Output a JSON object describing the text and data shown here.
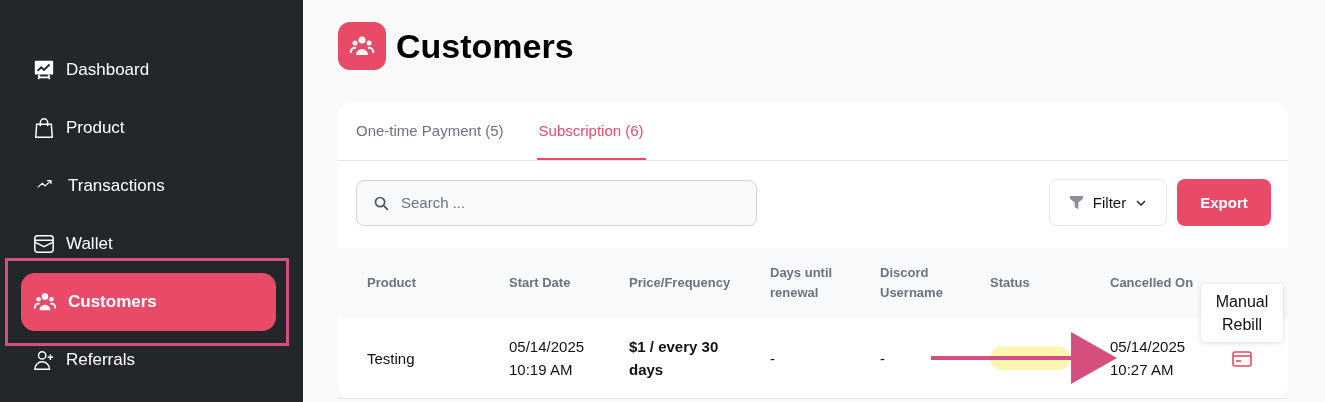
{
  "sidebar": {
    "items": [
      {
        "label": "Dashboard",
        "kind": "dashboard",
        "selected": false
      },
      {
        "label": "Product",
        "kind": "bag",
        "selected": false
      },
      {
        "label": "Transactions",
        "kind": "trend",
        "selected": false
      },
      {
        "label": "Wallet",
        "kind": "wallet",
        "selected": false
      },
      {
        "label": "Customers",
        "kind": "users",
        "selected": true
      },
      {
        "label": "Referrals",
        "kind": "user-plus",
        "selected": false
      }
    ]
  },
  "page": {
    "title": "Customers"
  },
  "tabs": [
    {
      "label": "One-time Payment (5)",
      "selected": false
    },
    {
      "label": "Subscription (6)",
      "selected": true
    }
  ],
  "search": {
    "placeholder": "Search ..."
  },
  "filter_button": "Filter",
  "export_button": "Export",
  "table": {
    "columns": [
      "Product",
      "Start Date",
      "Price/Frequency",
      "Days until renewal",
      "Discord Username",
      "Status",
      "Cancelled On"
    ],
    "rows": [
      {
        "cells": [
          {
            "kind": "text",
            "text": "Testing"
          },
          {
            "kind": "text",
            "text": "05/14/2025 10:19 AM"
          },
          {
            "kind": "bold",
            "text": "$1 / every 30 days"
          },
          {
            "kind": "text",
            "text": "-"
          },
          {
            "kind": "text",
            "text": "-"
          },
          {
            "kind": "badge"
          },
          {
            "kind": "text",
            "text": "05/14/2025 10:27 AM"
          },
          {
            "kind": "action",
            "tooltip": "Manual Rebill"
          }
        ]
      }
    ]
  }
}
